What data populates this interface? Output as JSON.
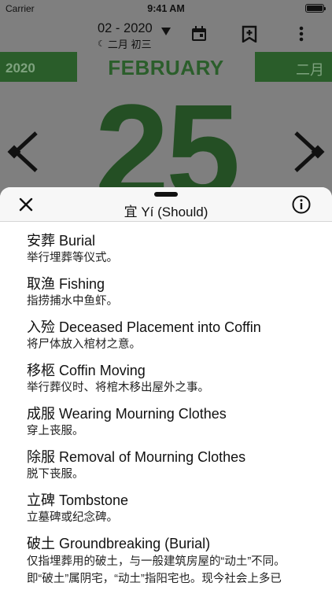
{
  "status": {
    "carrier": "Carrier",
    "time": "9:41 AM"
  },
  "nav": {
    "date": "02 - 2020",
    "lunar": "二月 初三"
  },
  "banner": {
    "year": "2020",
    "month": "FEBRUARY",
    "lunar_month": "二月"
  },
  "day": "25",
  "sheet": {
    "title": "宜 Yí (Should)"
  },
  "items": [
    {
      "title": "安葬 Burial",
      "desc": "举行埋葬等仪式。"
    },
    {
      "title": "取渔 Fishing",
      "desc": "指捞捕水中鱼虾。"
    },
    {
      "title": "入殓 Deceased Placement into Coffin",
      "desc": "将尸体放入棺材之意。"
    },
    {
      "title": "移柩 Coffin Moving",
      "desc": "举行葬仪时、将棺木移出屋外之事。"
    },
    {
      "title": "成服 Wearing Mourning Clothes",
      "desc": "穿上丧服。"
    },
    {
      "title": "除服 Removal of Mourning Clothes",
      "desc": "脱下丧服。"
    },
    {
      "title": "立碑 Tombstone",
      "desc": "立墓碑或纪念碑。"
    },
    {
      "title": "破土 Groundbreaking (Burial)",
      "desc": "仅指埋葬用的破土，与一般建筑房屋的“动土”不同。",
      "desc2": "即“破土”属阴宅，“动土”指阳宅也。现今社会上多已"
    }
  ],
  "colors": {
    "accent_green": "#2a5d2a",
    "sheet_header": "#f7f7f7"
  }
}
